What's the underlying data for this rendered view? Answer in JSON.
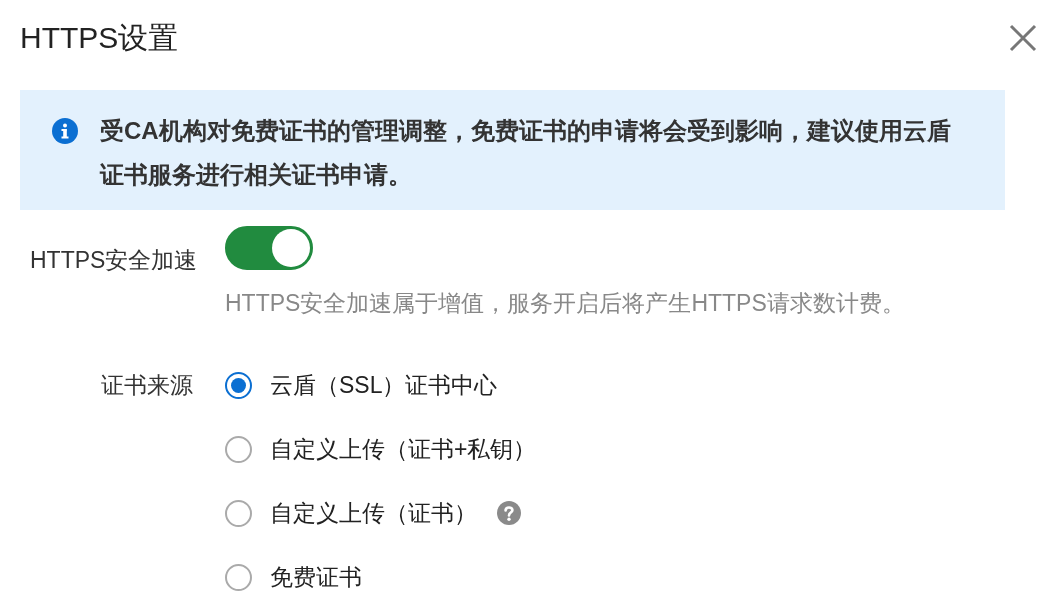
{
  "dialog": {
    "title": "HTTPS设置"
  },
  "notice": {
    "text": "受CA机构对免费证书的管理调整，免费证书的申请将会受到影响，建议使用云盾证书服务进行相关证书申请。"
  },
  "fields": [
    {
      "kind": "switch",
      "label": "HTTPS安全加速",
      "on": true,
      "hint": "HTTPS安全加速属于增值，服务开启后将产生HTTPS请求数计费。"
    },
    {
      "kind": "radio_group",
      "label": "证书来源",
      "options": [
        {
          "label": "云盾（SSL）证书中心",
          "selected": true,
          "help": false
        },
        {
          "label": "自定义上传（证书+私钥）",
          "selected": false,
          "help": false
        },
        {
          "label": "自定义上传（证书）",
          "selected": false,
          "help": true
        },
        {
          "label": "免费证书",
          "selected": false,
          "help": false
        }
      ]
    }
  ]
}
